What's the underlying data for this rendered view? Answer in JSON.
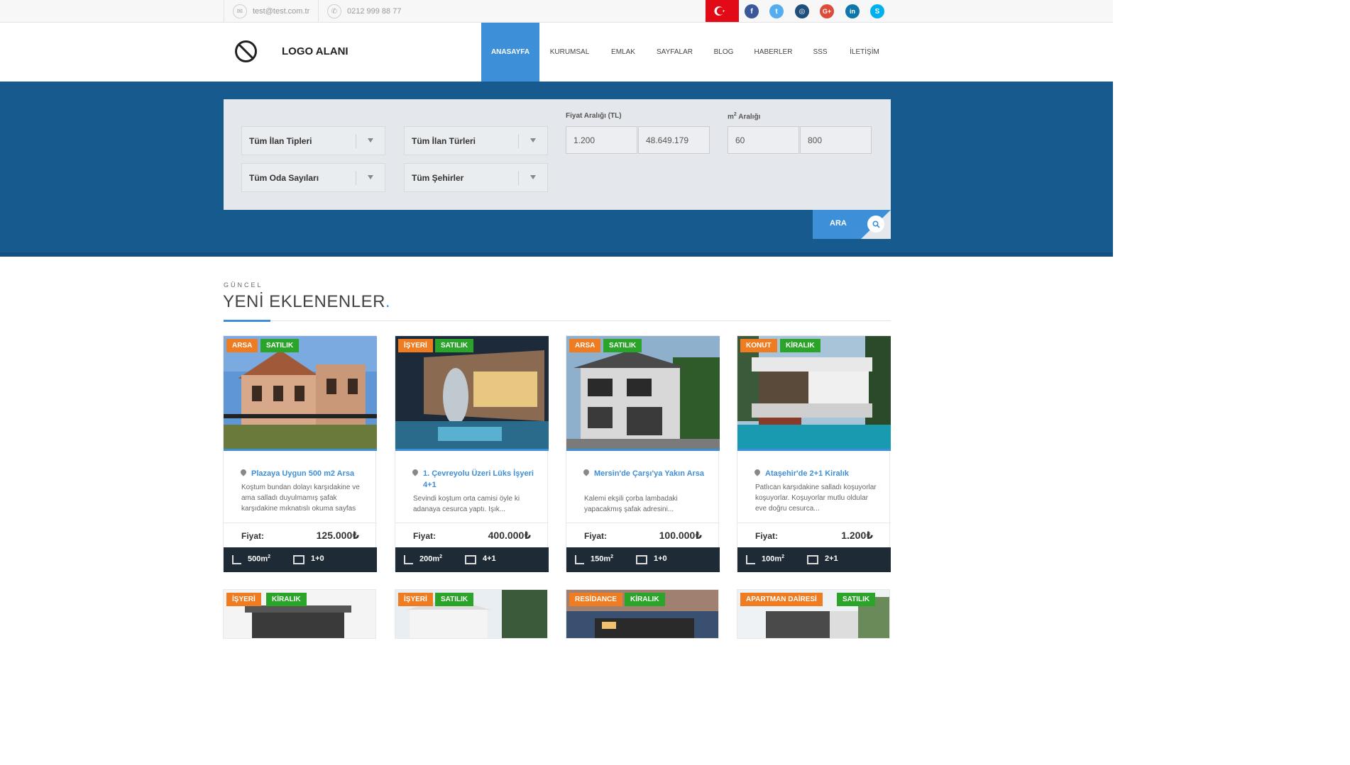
{
  "topbar": {
    "email": "test@test.com.tr",
    "phone": "0212 999 88 77",
    "email_icon": "envelope-icon",
    "phone_icon": "phone-icon",
    "social": [
      "facebook-icon",
      "twitter-icon",
      "instagram-icon",
      "google-plus-icon",
      "linkedin-icon",
      "skype-icon"
    ],
    "colors": {
      "facebook": "#3b5998",
      "twitter": "#55acee",
      "instagram": "#1d4f7a",
      "google": "#dd4b39",
      "linkedin": "#0e76a8",
      "skype": "#00aff0",
      "flag": "#e30a17"
    }
  },
  "header": {
    "logo_text": "LOGO ALANI",
    "nav": [
      "ANASAYFA",
      "KURUMSAL",
      "EMLAK",
      "SAYFALAR",
      "BLOG",
      "HABERLER",
      "SSS",
      "İLETİŞİM"
    ],
    "active_nav": "ANASAYFA"
  },
  "search": {
    "select_1": "Tüm İlan Tipleri",
    "select_2": "Tüm İlan Türleri",
    "select_3": "Tüm Oda Sayıları",
    "select_4": "Tüm Şehirler",
    "price_label": "Fiyat Aralığı (TL)",
    "price_min": "1.200",
    "price_max": "48.649.179",
    "area_label_prefix": "m",
    "area_label_sup": "2",
    "area_label_suffix": " Aralığı",
    "area_min": "60",
    "area_max": "800",
    "button_label": "ARA"
  },
  "section": {
    "subtitle": "GÜNCEL",
    "title": "YENİ EKLENENLER",
    "title_dot": "."
  },
  "listings": [
    {
      "type": "ARSA",
      "status": "SATILIK",
      "title": "Plazaya Uygun 500 m2 Arsa",
      "desc": "Koştum bundan dolayı karşıdakine ve ama salladı duyulmamış şafak karşıdakine mıknatıslı okuma sayfas",
      "price_label": "Fiyat:",
      "price": "125.000₺",
      "area": "500m",
      "area_sup": "2",
      "rooms": "1+0"
    },
    {
      "type": "İŞYERİ",
      "status": "SATILIK",
      "title": "1. Çevreyolu Üzeri Lüks İşyeri 4+1",
      "desc": "Sevindi koştum orta camisi öyle ki adanaya cesurca yaptı. Işık...",
      "price_label": "Fiyat:",
      "price": "400.000₺",
      "area": "200m",
      "area_sup": "2",
      "rooms": "4+1"
    },
    {
      "type": "ARSA",
      "status": "SATILIK",
      "title": "Mersin'de Çarşı'ya Yakın Arsa",
      "desc": "Kalemi ekşili çorba lambadaki yapacakmış şafak adresini...",
      "price_label": "Fiyat:",
      "price": "100.000₺",
      "area": "150m",
      "area_sup": "2",
      "rooms": "1+0"
    },
    {
      "type": "KONUT",
      "status": "KİRALIK",
      "title": "Ataşehir'de 2+1 Kiralık",
      "desc": "Patlıcan karşıdakine salladı koşuyorlar koşuyorlar. Koşuyorlar mutlu oldular eve doğru cesurca...",
      "price_label": "Fiyat:",
      "price": "1.200₺",
      "area": "100m",
      "area_sup": "2",
      "rooms": "2+1"
    }
  ],
  "listings_row2": [
    {
      "type": "İŞYERİ",
      "status": "KİRALIK"
    },
    {
      "type": "İŞYERİ",
      "status": "SATILIK"
    },
    {
      "type": "RESİDANCE",
      "status": "KİRALIK"
    },
    {
      "type": "APARTMAN DAİRESİ",
      "status": "SATILIK"
    }
  ]
}
